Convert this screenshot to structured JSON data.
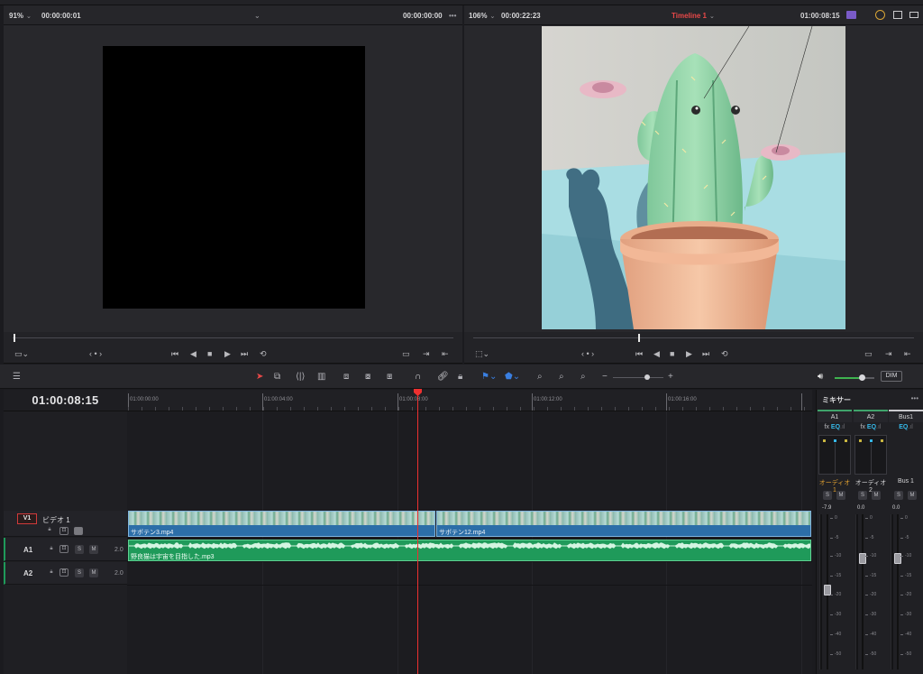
{
  "source_viewer": {
    "zoom": "91%",
    "timecode": "00:00:00:01",
    "timecode_right": "00:00:00:00"
  },
  "timeline_viewer": {
    "zoom": "106%",
    "duration": "00:00:22:23",
    "timeline_name": "Timeline 1",
    "timecode": "01:00:08:15"
  },
  "timeline": {
    "current_timecode": "01:00:08:15",
    "ruler_labels": [
      "01:00:00:00",
      "01:00:04:00",
      "01:00:08:00",
      "01:00:12:00",
      "01:00:16:00"
    ],
    "tracks": {
      "v1": {
        "tag": "V1",
        "name": "ビデオ 1"
      },
      "a1": {
        "tag": "A1",
        "channels": "2.0"
      },
      "a2": {
        "tag": "A2",
        "channels": "2.0"
      }
    },
    "clips": {
      "video1": "サボテン3.mp4",
      "video2": "サボテン12.mp4",
      "audio1": "野良猫は宇宙を目指した.mp3"
    },
    "solo_label": "S",
    "mute_label": "M",
    "dim_label": "DIM"
  },
  "mixer": {
    "title": "ミキサー",
    "channels": [
      {
        "head": "A1",
        "name": "オーディオ 1",
        "value": "-7.9",
        "name_color": "#e0a030"
      },
      {
        "head": "A2",
        "name": "オーディオ 2",
        "value": "0.0",
        "name_color": "#d6d6d8"
      },
      {
        "head": "Bus1",
        "name": "Bus 1",
        "value": "0.0",
        "name_color": "#d6d6d8"
      }
    ],
    "fx_label": "fx",
    "eq_label": "EQ",
    "scale": [
      "0",
      "-5",
      "-10",
      "-15",
      "-20",
      "-30",
      "-40",
      "-50"
    ]
  },
  "colors": {
    "playhead": "#ee3030",
    "video_clip": "#2c6ea8",
    "audio_clip": "#1f9a5a",
    "accent_timeline_name": "#e84848",
    "eq_badge": "#36b8e8"
  }
}
